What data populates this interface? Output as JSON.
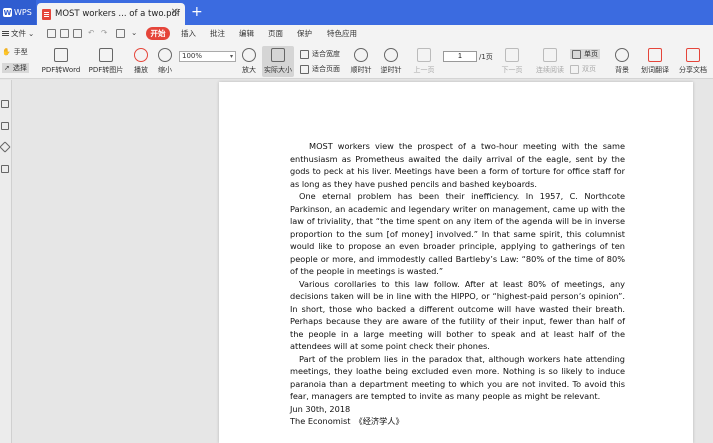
{
  "tabs": {
    "app_label": "WPS",
    "doc_title": "MOST workers ... of a two.pdf",
    "close_glyph": "✕",
    "new_tab_glyph": "+"
  },
  "menu": {
    "file": "文件",
    "start": "开始",
    "items": [
      "插入",
      "批注",
      "编辑",
      "页面",
      "保护",
      "特色应用"
    ]
  },
  "ribbon": {
    "hand": "手型",
    "select": "选择",
    "pdf_to_word": "PDF转Word",
    "pdf_to_image": "PDF转图片",
    "play": "播放",
    "zoom_out": "缩小",
    "zoom_value": "100%",
    "zoom_in": "放大",
    "actual_size": "实际大小",
    "fit_width": "适合宽度",
    "fit_page": "适合页面",
    "rotate_cw": "顺时针",
    "rotate_ccw": "逆时针",
    "prev_page": "上一页",
    "page_current": "1",
    "page_total": "/1页",
    "next_page": "下一页",
    "continuous": "连续阅读",
    "single": "单页",
    "double": "双页",
    "background": "背景",
    "translate": "划词翻译",
    "share": "分享文档"
  },
  "document": {
    "paragraphs": [
      "MOST workers view the prospect of a two-hour meeting with the same enthusiasm as Prometheus awaited the daily arrival of the eagle, sent by the gods to peck at his liver. Meetings have been a form of torture for office staff for as long as they have pushed pencils and bashed keyboards.",
      "One eternal problem has been their inefficiency. In 1957, C. Northcote Parkinson, an academic    and legendary writer on management, came up with the law of triviality, that “the time spent on any item of the agenda will be in inverse proportion to the sum [of money] involved.” In that same spirit, this columnist would like to propose an even broader principle, applying to gatherings of ten people or more, and immodestly called Bartleby’s Law: “80% of the time of 80% of the people in meetings is wasted.”",
      "Various corollaries to this law follow. After at least 80% of meetings, any decisions taken will be in line with the HIPPO, or “highest-paid person’s opinion”. In short, those who backed a different outcome will have wasted their breath. Perhaps because they are aware of the futility of their input, fewer than half of the people in a large meeting will bother to speak and at least half of the attendees will at some point check their phones.",
      "Part of the problem lies in the paradox that, although workers hate attending meetings, they loathe being excluded even more. Nothing is so likely to induce paranoia than a department meeting to which you are not invited. To avoid this fear, managers are tempted to invite as many people as might be relevant."
    ],
    "date": "Jun 30th, 2018",
    "source": "The Economist　《经济学人》"
  }
}
